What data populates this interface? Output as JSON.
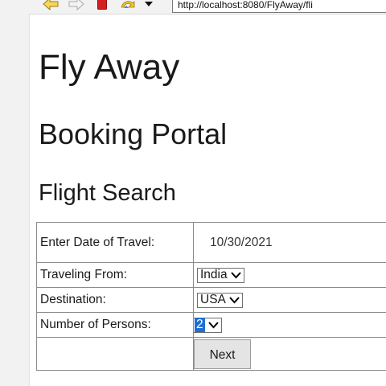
{
  "browser": {
    "url": "http://localhost:8080/FlyAway/fli",
    "icons": [
      "back-arrow-icon",
      "forward-arrow-icon",
      "stop-icon",
      "refresh-icon",
      "dropdown-icon"
    ]
  },
  "page": {
    "title": "Fly Away",
    "subtitle": "Booking Portal",
    "section_title": "Flight Search"
  },
  "form": {
    "date_label": "Enter Date of Travel:",
    "date_value": "10/30/2021",
    "from_label": "Traveling From:",
    "from_value": "India",
    "destination_label": "Destination:",
    "destination_value": "USA",
    "persons_label": "Number of Persons:",
    "persons_value": "2",
    "next_label": "Next"
  },
  "colors": {
    "selection": "#1f6fd1",
    "stop_red": "#d42020",
    "arrow_yellow": "#f2c530"
  }
}
